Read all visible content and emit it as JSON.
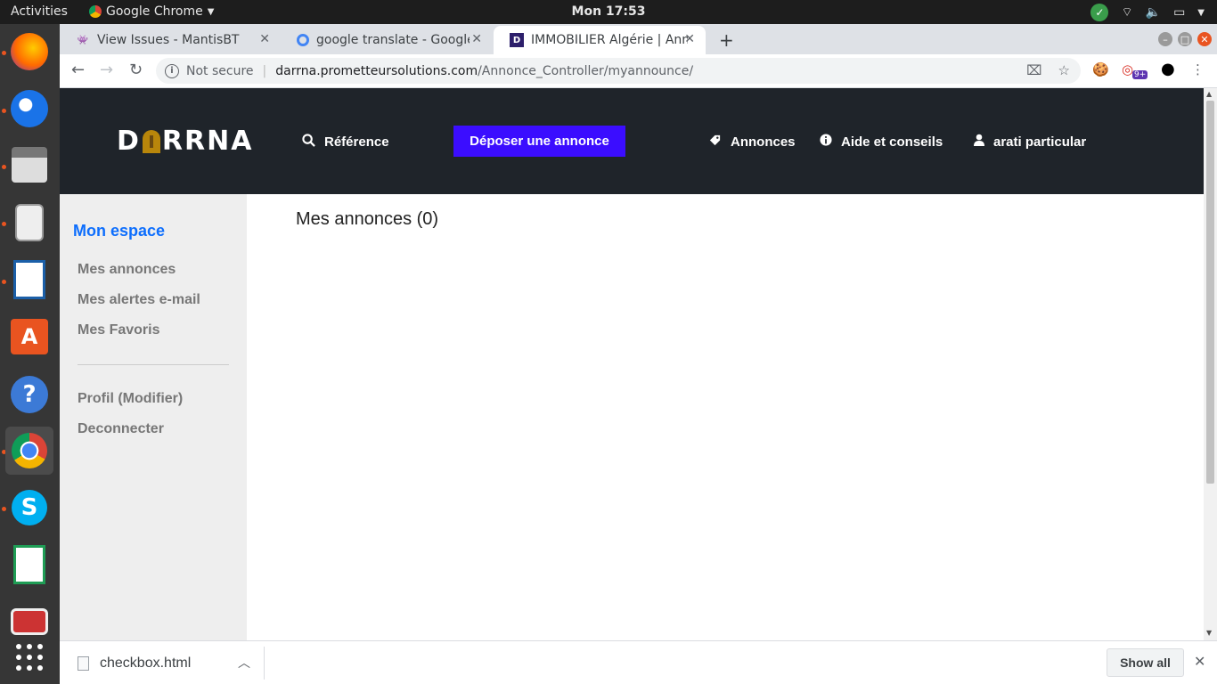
{
  "system": {
    "activities": "Activities",
    "app_name": "Google Chrome",
    "clock": "Mon 17:53"
  },
  "dock": {
    "items": [
      "firefox-icon",
      "thunderbird-icon",
      "files-icon",
      "rhythmbox-icon",
      "writer-icon",
      "software-icon",
      "help-icon",
      "chrome-icon",
      "skype-icon",
      "calc-icon",
      "remmina-icon",
      "apps-grid-icon"
    ]
  },
  "browser": {
    "tabs": [
      {
        "title": "View Issues - MantisBT"
      },
      {
        "title": "google translate - Google"
      },
      {
        "title": "IMMOBILIER Algérie | Ann"
      }
    ],
    "omnibox": {
      "security": "Not secure",
      "host": "darrna.prometteursolutions.com",
      "path": "/Annonce_Controller/myannounce/"
    },
    "extension_badge": "9+"
  },
  "site": {
    "logo_left": "D",
    "logo_right": "RRNA",
    "nav": {
      "reference": "Référence",
      "cta": "Déposer une annonce",
      "annonces": "Annonces",
      "aide": "Aide et conseils",
      "user": "arati particular"
    },
    "sidebar": {
      "heading": "Mon espace",
      "items": [
        "Mes annonces",
        "Mes alertes e-mail",
        "Mes Favoris"
      ],
      "items2": [
        "Profil (Modifier)",
        "Deconnecter"
      ]
    },
    "main_title": "Mes annonces (0)"
  },
  "downloads": {
    "file": "checkbox.html",
    "show_all": "Show all"
  },
  "colors": {
    "header_bg": "#1f242a",
    "cta_bg": "#3b0dff",
    "sidebar_heading": "#0d6efd"
  }
}
